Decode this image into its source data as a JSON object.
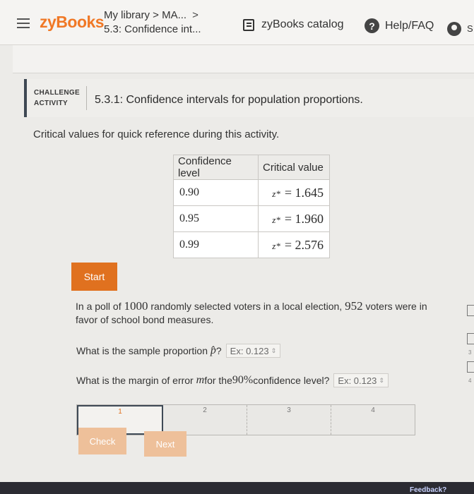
{
  "header": {
    "logo": "zyBooks",
    "breadcrumb_top": "My library > MA...",
    "breadcrumb_chevron": ">",
    "breadcrumb_bottom": "5.3: Confidence int...",
    "catalog_label": "zyBooks catalog",
    "help_label": "Help/FAQ",
    "help_glyph": "?",
    "user_initial": "S"
  },
  "activity": {
    "label_line1": "CHALLENGE",
    "label_line2": "ACTIVITY",
    "title": "5.3.1: Confidence intervals for population proportions."
  },
  "intro": "Critical values for quick reference during this activity.",
  "table": {
    "headers": [
      "Confidence level",
      "Critical value"
    ],
    "rows": [
      {
        "level": "0.90",
        "z": "z*",
        "eq": "= 1.645"
      },
      {
        "level": "0.95",
        "z": "z*",
        "eq": "= 1.960"
      },
      {
        "level": "0.99",
        "z": "z*",
        "eq": "= 2.576"
      }
    ]
  },
  "start_label": "Start",
  "problem": {
    "p1": "In a poll of ",
    "n": "1000",
    "p2": " randomly selected voters in a local election, ",
    "k": "952",
    "p3": " voters were in favor of school bond measures.",
    "q1_text": "What is the sample proportion ",
    "q1_sym": "p̂",
    "q1_end": "?",
    "q1_placeholder": "Ex: 0.123",
    "q2_text": "What is the margin of error ",
    "q2_sym": "m",
    "q2_mid": " for the ",
    "q2_pct": "90%",
    "q2_end": " confidence level?",
    "q2_placeholder": "Ex: 0.123"
  },
  "progress": {
    "steps": [
      "1",
      "2",
      "3",
      "4"
    ],
    "current": 1
  },
  "check_label": "Check",
  "next_label": "Next",
  "feedback_label": "Feedback?",
  "edge_numbers": [
    "3",
    "4"
  ],
  "colors": {
    "brand": "#f07826",
    "accent": "#e0711f",
    "disabled": "#eec09a"
  }
}
